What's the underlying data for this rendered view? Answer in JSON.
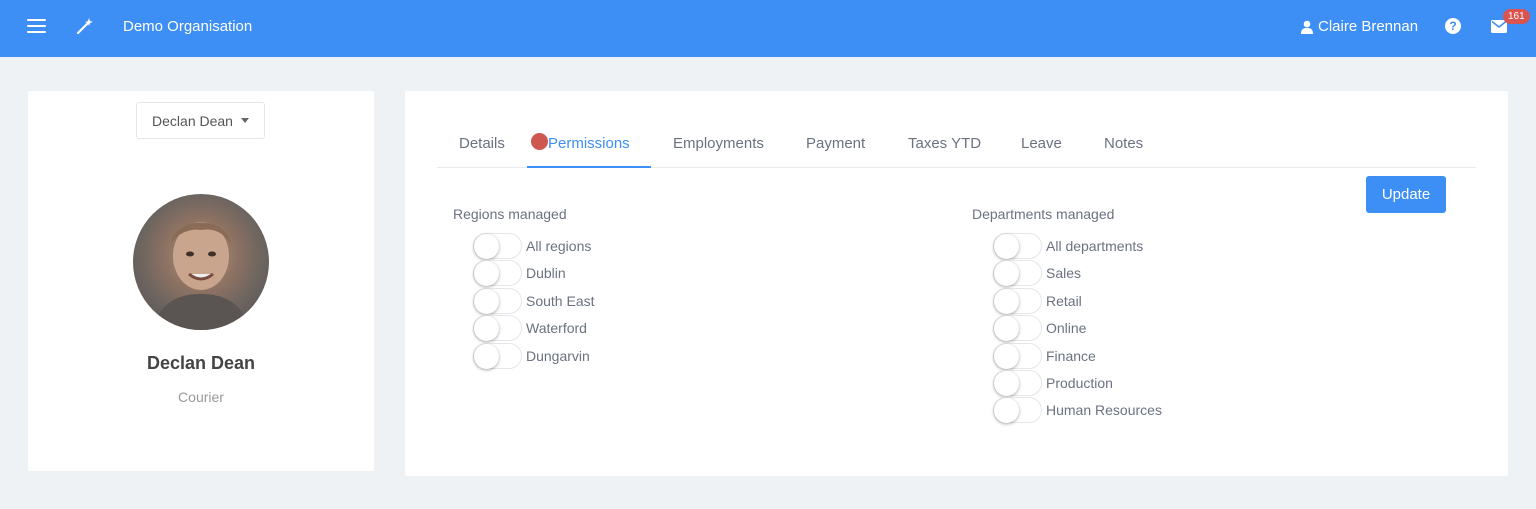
{
  "header": {
    "org_name": "Demo Organisation",
    "user_name": "Claire Brennan",
    "mail_count": "161",
    "icons": [
      "menu-icon",
      "wand-icon",
      "user-icon",
      "help-icon",
      "mail-icon"
    ]
  },
  "profile": {
    "selector_value": "Declan Dean",
    "name": "Declan Dean",
    "role": "Courier"
  },
  "tabs": [
    {
      "label": "Details"
    },
    {
      "label": "Permissions"
    },
    {
      "label": "Employments"
    },
    {
      "label": "Payment"
    },
    {
      "label": "Taxes YTD"
    },
    {
      "label": "Leave"
    },
    {
      "label": "Notes"
    }
  ],
  "active_tab": "Permissions",
  "update_label": "Update",
  "regions": {
    "title": "Regions managed",
    "items": [
      {
        "label": "All regions",
        "enabled": false
      },
      {
        "label": "Dublin",
        "enabled": false
      },
      {
        "label": "South East",
        "enabled": false
      },
      {
        "label": "Waterford",
        "enabled": false
      },
      {
        "label": "Dungarvin",
        "enabled": false
      }
    ]
  },
  "departments": {
    "title": "Departments managed",
    "items": [
      {
        "label": "All departments",
        "enabled": false
      },
      {
        "label": "Sales",
        "enabled": false
      },
      {
        "label": "Retail",
        "enabled": false
      },
      {
        "label": "Online",
        "enabled": false
      },
      {
        "label": "Finance",
        "enabled": false
      },
      {
        "label": "Production",
        "enabled": false
      },
      {
        "label": "Human Resources",
        "enabled": false
      }
    ]
  },
  "colors": {
    "accent": "#3d8ef5",
    "badge": "#d9534f"
  }
}
